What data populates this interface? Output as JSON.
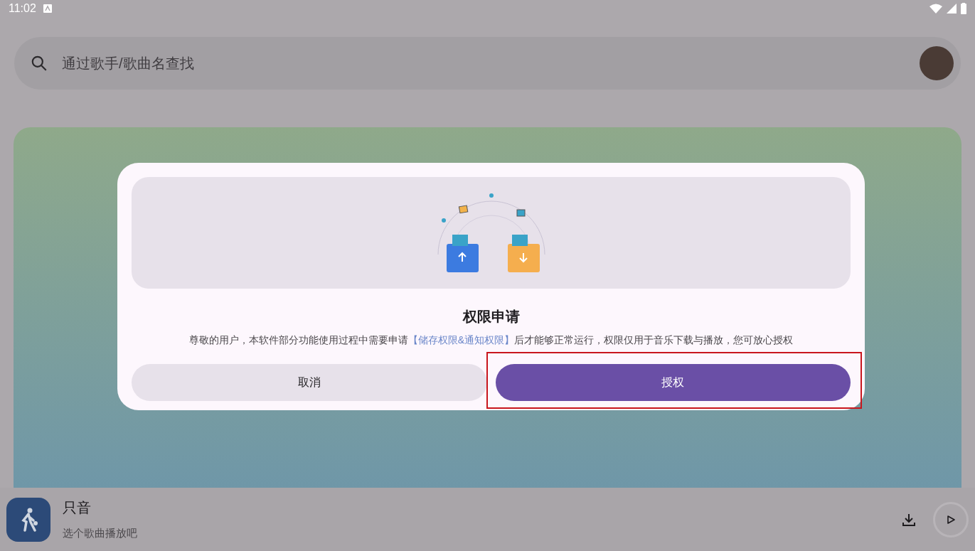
{
  "status_bar": {
    "time": "11:02"
  },
  "search": {
    "placeholder": "通过歌手/歌曲名查找"
  },
  "dialog": {
    "title": "权限申请",
    "message": [
      {
        "kind": "text",
        "text": "尊敬的用户，本软件部分功能使用过程中需要申请"
      },
      {
        "kind": "link",
        "text": "【储存权限&通知权限】"
      },
      {
        "kind": "text",
        "text": "后才能够正常运行，权限仅用于音乐下载与播放，您可放心授权"
      }
    ],
    "buttons": [
      {
        "label": "取消",
        "kind": "secondary",
        "highlighted": false
      },
      {
        "label": "授权",
        "kind": "primary",
        "highlighted": true
      }
    ]
  },
  "player": {
    "title": "只音",
    "subtitle": "选个歌曲播放吧"
  }
}
